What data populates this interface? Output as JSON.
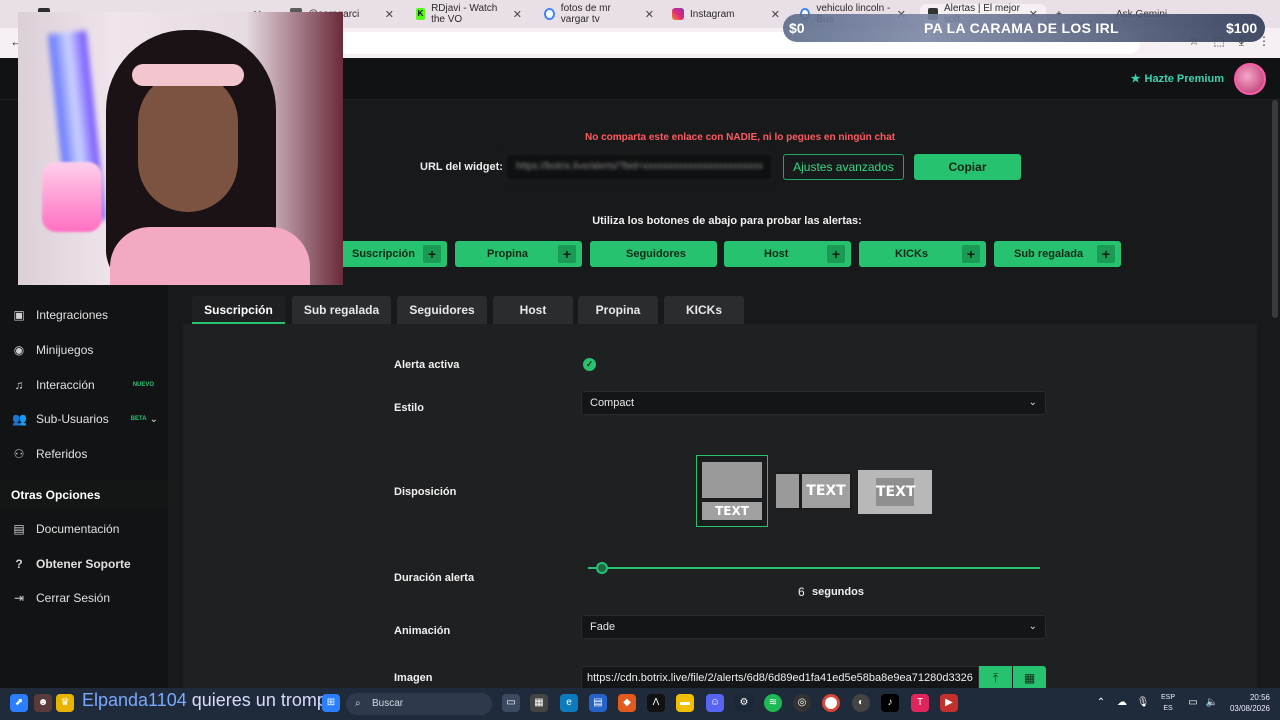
{
  "browser": {
    "tabs": [
      {
        "label": "",
        "icon": "tab-favicon",
        "color": "#2d2d2d"
      },
      {
        "label": "",
        "icon": "tab-favicon",
        "color": "#2d2d2d"
      },
      {
        "label": "@saragarci",
        "icon": "tab-favicon",
        "color": "#5b5b5b"
      },
      {
        "label": "RDjavi - Watch the VO",
        "icon": "kick-icon",
        "color": "#53fc18"
      },
      {
        "label": "fotos de mr vargar tv",
        "icon": "google-icon",
        "color": "#4285f4"
      },
      {
        "label": "Instagram",
        "icon": "instagram-icon",
        "color": "#e1306c"
      },
      {
        "label": "vehiculo lincoln - Bus",
        "icon": "google-icon",
        "color": "#4285f4"
      },
      {
        "label": "Alertas | El mejor soft",
        "icon": "botrix-icon",
        "color": "#333333"
      }
    ],
    "ask_label": "Ask Gemini"
  },
  "overlay": {
    "goal_start": "$0",
    "goal_title": "PA LA CARAMA DE LOS IRL",
    "goal_end": "$100",
    "chat_user": "Elpanda1104",
    "chat_message": " quieres un tromp"
  },
  "header": {
    "premium_label": "Hazte Premium"
  },
  "sidebar": {
    "items": [
      {
        "label": "Integraciones",
        "icon": "integrations-icon"
      },
      {
        "label": "Minijuegos",
        "icon": "gamepad-icon"
      },
      {
        "label": "Interacción",
        "icon": "music-note-icon",
        "badge": "NUEVO",
        "badge_color": "#27c26f"
      },
      {
        "label": "Sub-Usuarios",
        "icon": "users-icon",
        "badge": "BETA",
        "badge_color": "#27c26f"
      },
      {
        "label": "Referidos",
        "icon": "referrals-icon"
      }
    ],
    "section_title": "Otras Opciones",
    "other_items": [
      {
        "label": "Documentación",
        "icon": "document-icon"
      },
      {
        "label": "Obtener Soporte",
        "icon": "help-icon"
      },
      {
        "label": "Cerrar Sesión",
        "icon": "logout-icon"
      }
    ]
  },
  "widget": {
    "warning": "No comparta este enlace con NADIE, ni lo pegues en ningún chat",
    "url_label": "URL del widget:",
    "url_value": "https://botrix.live/alerts/?bid=xxxxxxxxxxxxxxxxxxxxxxxx",
    "advanced_label": "Ajustes avanzados",
    "copy_label": "Copiar",
    "test_hint": "Utiliza los botones de abajo para probar las alertas:",
    "test_buttons": [
      "Suscripción",
      "Propina",
      "Seguidores",
      "Host",
      "KICKs",
      "Sub regalada"
    ]
  },
  "tabs": [
    "Suscripción",
    "Sub regalada",
    "Seguidores",
    "Host",
    "Propina",
    "KICKs"
  ],
  "active_tab": "Suscripción",
  "form": {
    "active_label": "Alerta activa",
    "active_checked": true,
    "style_label": "Estilo",
    "style_value": "Compact",
    "layout_label": "Disposición",
    "layout_text": "TEXT",
    "duration_label": "Duración alerta",
    "duration_value": "6",
    "duration_unit": "segundos",
    "duration_fraction": 0.03,
    "animation_label": "Animación",
    "animation_value": "Fade",
    "image_label": "Imagen",
    "image_value": "https://cdn.botrix.live/file/2/alerts/6d8/6d89ed1fa41ed5e58ba8e9ea71280d3326"
  },
  "taskbar": {
    "search_placeholder": "Buscar",
    "lang_top": "ESP",
    "lang_bottom": "ES",
    "time": "20:56",
    "date": "03/08/2026"
  },
  "colors": {
    "accent": "#27c26f",
    "warning": "#ff5a5f",
    "premium": "#37d4b0"
  }
}
